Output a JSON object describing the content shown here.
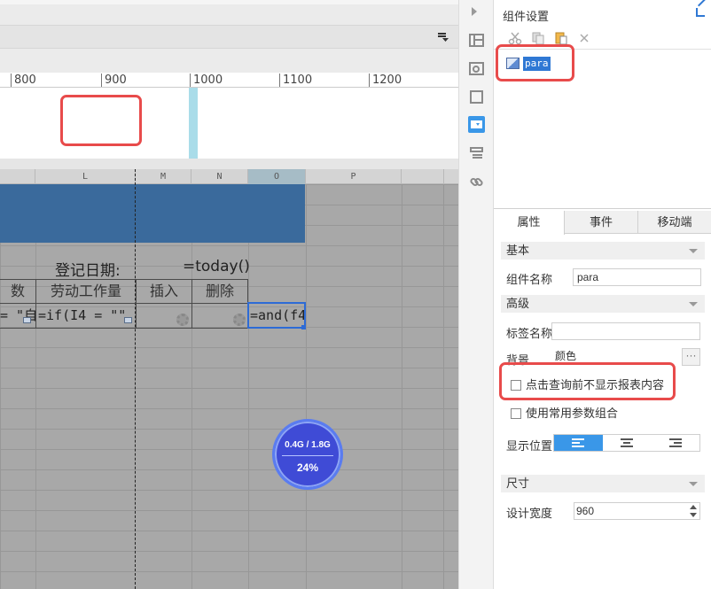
{
  "ruler": {
    "labels": [
      "800",
      "900",
      "1000",
      "1100",
      "1200"
    ]
  },
  "sheet": {
    "columns": [
      "L",
      "M",
      "N",
      "O",
      "P"
    ],
    "register_label": "登记日期:",
    "register_formula": "=today()",
    "headers": [
      "数",
      "劳动工作量",
      "插入",
      "删除"
    ],
    "row": {
      "c1": "= \"自",
      "c2": "=if(I4 = \"\"",
      "c5": "=and(f4"
    }
  },
  "gauge": {
    "memory": "0.4G / 1.8G",
    "percent": "24%"
  },
  "panel": {
    "title": "组件设置",
    "tree_node": "para",
    "tabs": [
      "属性",
      "事件",
      "移动端"
    ],
    "sections": {
      "basic": "基本",
      "advanced": "高级",
      "size": "尺寸"
    },
    "fields": {
      "component_name_label": "组件名称",
      "component_name_value": "para",
      "tag_name_label": "标签名称",
      "tag_name_value": "",
      "background_label": "背景",
      "background_value": "颜色",
      "display_position_label": "显示位置",
      "design_width_label": "设计宽度",
      "design_width_value": "960"
    },
    "checkboxes": {
      "no_show_before_query": "点击查询前不显示报表内容",
      "use_common_params": "使用常用参数组合"
    }
  },
  "colors": {
    "accent": "#3a97e8",
    "highlight": "#e84b4b",
    "title_band": "#3a6a9c"
  }
}
